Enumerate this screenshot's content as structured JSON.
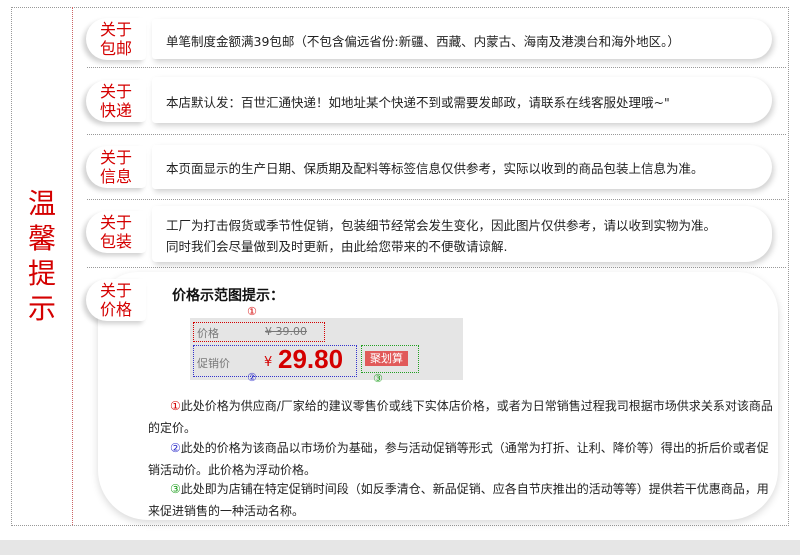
{
  "side_title": [
    "温",
    "馨",
    "提",
    "示"
  ],
  "rows": [
    {
      "badge": [
        "关于",
        "包邮"
      ],
      "text": [
        "单笔制度金额满39包邮（不包含偏远省份:新疆、西藏、内蒙古、海南及港澳台和海外地区。）"
      ]
    },
    {
      "badge": [
        "关于",
        "快递"
      ],
      "text": [
        "本店默认发：百世汇通快递！如地址某个快递不到或需要发邮政，请联系在线客服处理哦~\""
      ]
    },
    {
      "badge": [
        "关于",
        "信息"
      ],
      "text": [
        "本页面显示的生产日期、保质期及配料等标签信息仅供参考，实际以收到的商品包装上信息为准。"
      ]
    },
    {
      "badge": [
        "关于",
        "包装"
      ],
      "text": [
        "工厂为打击假货或季节性促销，包装细节经常会发生变化，因此图片仅供参考，请以收到实物为准。",
        "同时我们会尽量做到及时更新，由此给您带来的不便敬请谅解."
      ]
    }
  ],
  "price_section": {
    "badge": [
      "关于",
      "价格"
    ],
    "title": "价格示范图提示：",
    "demo": {
      "marker1": "①",
      "marker2": "②",
      "marker3": "③",
      "list_label": "价格",
      "list_price": "¥ 39.00",
      "promo_label": "促销价",
      "currency": "¥",
      "promo_price": "29.80",
      "tag": "聚划算"
    },
    "notes": [
      {
        "num": "①",
        "text": "此处价格为供应商/厂家给的建议零售价或线下实体店价格，或者为日常销售过程我司根据市场供求关系对该商品的定价。"
      },
      {
        "num": "②",
        "text": "此处的价格为该商品以市场价为基础，参与活动促销等形式（通常为打折、让利、降价等）得出的折后价或者促销活动价。此价格为浮动价格。"
      },
      {
        "num": "③",
        "text": "此处即为店铺在特定促销时间段（如反季清仓、新品促销、应各自节庆推出的活动等等）提供若干优惠商品，用来促进销售的一种活动名称。"
      }
    ]
  },
  "colors": {
    "accent": "#d40000",
    "marker2": "#3333cc",
    "marker3": "#22a022"
  }
}
